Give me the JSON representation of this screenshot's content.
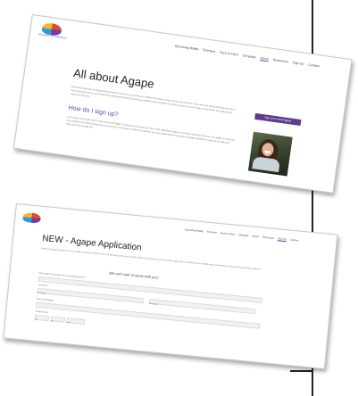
{
  "page1": {
    "logo_text": "JOURNEY OF EMMAUS",
    "nav": [
      "Upcoming Walks",
      "Emmaus",
      "Face to Face",
      "Chrysalis",
      "About",
      "Resources",
      "Sign Up",
      "Contact"
    ],
    "active_nav": "About",
    "title": "All about Agape",
    "intro": "Remember all those wonderful things that were done for you during your Walk to Emmaus or Face to Face Encounter? Those were the physical hands and feet of God reaching down to you! You'll find it (and god himself) by working a weekend with yourself. You will be a part of a community of people who are dedicated to sharing God's love.",
    "cta": "Sign up to send Agape",
    "subheading": "How do I sign up?",
    "body": "Good news! You don't need to sign up to send Agape. You just need to show up! If you have attended a walk or encounter weekend, then you are eligible to send and post. Mail it to the Pilot's at least one week before. Each team (a different volunteer for every walk) reports how many of Agape baskets to house up the different times and then people do!"
  },
  "page2": {
    "nav": [
      "Upcoming Walks",
      "Emmaus",
      "Face to Face",
      "Chrysalis",
      "About",
      "Resources",
      "Sign Up",
      "Contact"
    ],
    "active_nav": "Sign Up",
    "title": "NEW - Agape Application",
    "intro": "Below is an agape application form for a walk or encounter. Please fill out each field and submit once complete. Walks or Encounters are on the calendar. Agape that is received after the deadline may not be delivered. Thank you for supporting our pilgrims!",
    "heading": "We can't wait to serve with you!",
    "q1": "Which Walk or Encounter are you sending Agape for?",
    "your_name": "Your Name",
    "first": "First Name",
    "last": "Last Name",
    "email": "Your Email Address",
    "phone": "Primary Phone",
    "area": "###",
    "prefix": "###",
    "line": "####"
  }
}
